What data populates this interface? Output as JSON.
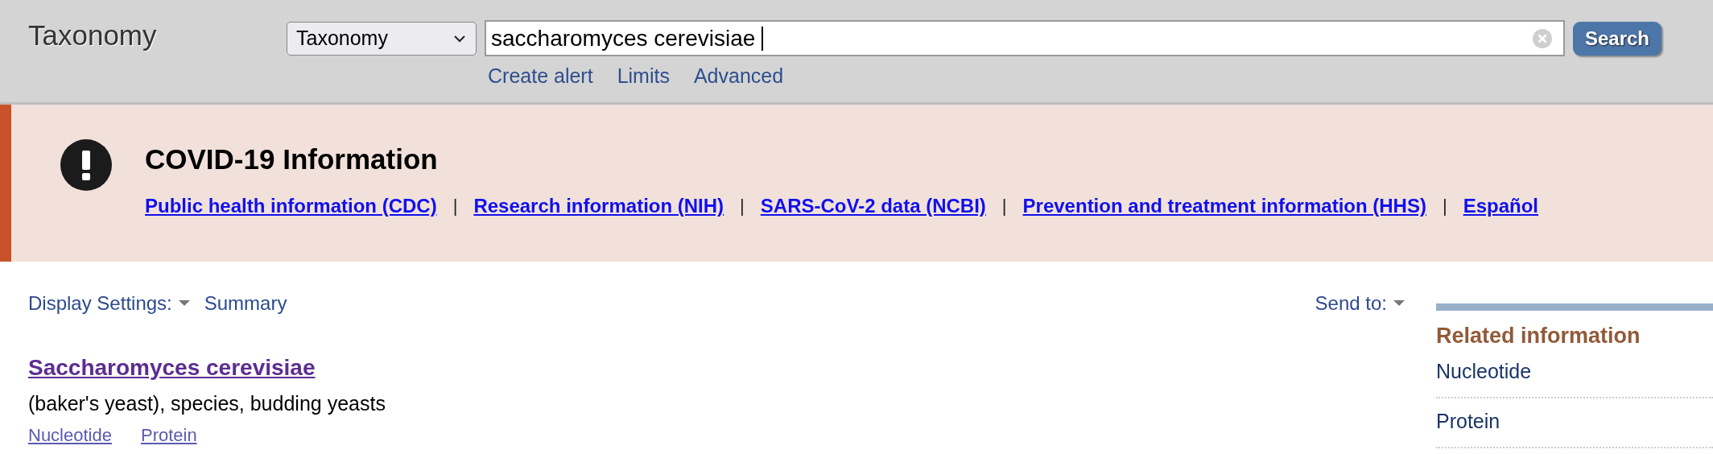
{
  "header": {
    "title": "Taxonomy",
    "database": "Taxonomy",
    "query": "saccharomyces cerevisiae",
    "search_button": "Search",
    "links": [
      "Create alert",
      "Limits",
      "Advanced"
    ]
  },
  "banner": {
    "title": "COVID-19 Information",
    "separator": "|",
    "links": [
      "Public health information (CDC)",
      "Research information (NIH)",
      "SARS-CoV-2 data (NCBI)",
      "Prevention and treatment information (HHS)",
      "Español"
    ]
  },
  "toolbar": {
    "display_settings": "Display Settings:",
    "format": "Summary",
    "send_to": "Send to:"
  },
  "result": {
    "title": "Saccharomyces cerevisiae",
    "description": "(baker's yeast), species, budding yeasts",
    "links": [
      "Nucleotide",
      "Protein"
    ]
  },
  "sidebar": {
    "title": "Related information",
    "items": [
      "Nucleotide",
      "Protein"
    ]
  }
}
